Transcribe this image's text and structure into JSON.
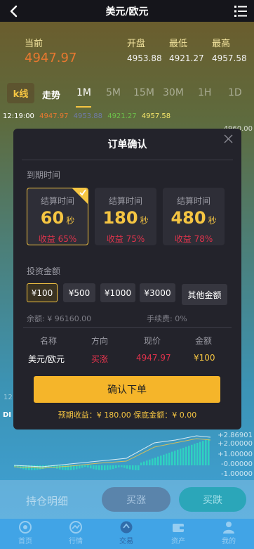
{
  "header": {
    "title": "美元/欧元",
    "back_icon": "back-arrow-icon",
    "menu_icon": "list-menu-icon"
  },
  "quote": {
    "current_label": "当前",
    "current_value": "4947.97",
    "open_label": "开盘",
    "open_value": "4953.88",
    "low_label": "最低",
    "low_value": "4921.27",
    "high_label": "最高",
    "high_value": "4957.58"
  },
  "tabs": {
    "kline": "k线",
    "trend": "走势",
    "periods": [
      "1M",
      "5M",
      "15M",
      "30M",
      "1H",
      "1D"
    ],
    "active": "1M"
  },
  "ticker": {
    "time": "12:19:00",
    "v1": "4947.97",
    "v2": "4953.88",
    "v3": "4921.27",
    "v4": "4957.58"
  },
  "chart_axis": {
    "top_label": "4960.00",
    "macd_labels": [
      "+2.86901",
      "+2.00000",
      "+1.00000",
      "-0.00000",
      "-1.00000"
    ]
  },
  "chart_side": {
    "left_label_1": "12",
    "left_label_2": "DI"
  },
  "modal": {
    "title": "订单确认",
    "expiry_label": "到期时间",
    "options": [
      {
        "label": "结算时间",
        "seconds": "60",
        "unit": "秒",
        "yield": "收益 65%",
        "selected": true
      },
      {
        "label": "结算时间",
        "seconds": "180",
        "unit": "秒",
        "yield": "收益 75%",
        "selected": false
      },
      {
        "label": "结算时间",
        "seconds": "480",
        "unit": "秒",
        "yield": "收益 78%",
        "selected": false
      }
    ],
    "amount_label": "投资金额",
    "amounts": [
      "¥100",
      "¥500",
      "¥1000",
      "¥3000",
      "其他金额"
    ],
    "balance": "余额: ¥ 96160.00",
    "fee": "手续费: 0%",
    "table_headers": [
      "名称",
      "方向",
      "现价",
      "金额"
    ],
    "row": {
      "name": "美元/欧元",
      "direction": "买涨",
      "price": "4947.97",
      "amount": "¥100"
    },
    "confirm_label": "确认下单",
    "footer": "预期收益：¥ 180.00   保底金额：¥ 0.00"
  },
  "bottom": {
    "holdings": "持仓明细",
    "buy_up": "买涨",
    "buy_down": "买跌"
  },
  "tabbar": [
    {
      "label": "首页",
      "icon": "home-icon"
    },
    {
      "label": "行情",
      "icon": "market-icon"
    },
    {
      "label": "交易",
      "icon": "trade-icon",
      "active": true
    },
    {
      "label": "资产",
      "icon": "wallet-icon"
    },
    {
      "label": "我的",
      "icon": "user-icon"
    }
  ],
  "colors": {
    "gold": "#f5c542",
    "red": "#e0334c",
    "orange": "#e8782f",
    "modal_bg": "#23232b"
  }
}
